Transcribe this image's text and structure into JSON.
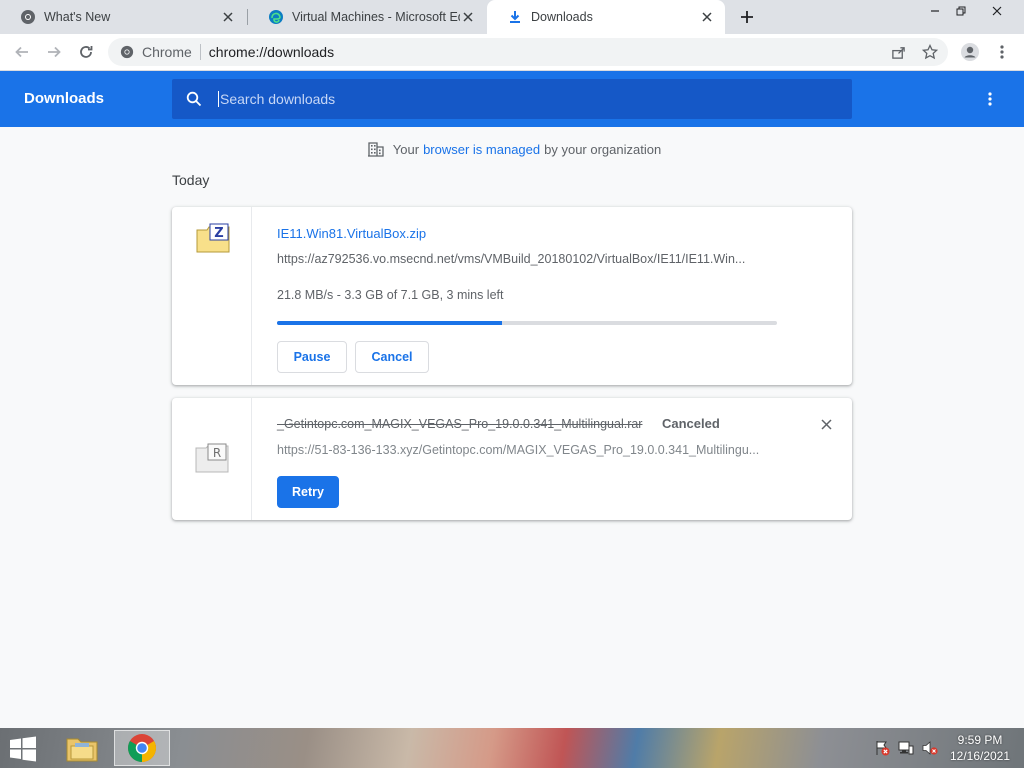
{
  "tabs": [
    {
      "title": "What's New",
      "icon": "chrome-icon"
    },
    {
      "title": "Virtual Machines - Microsoft Edg",
      "icon": "edge-icon"
    },
    {
      "title": "Downloads",
      "icon": "download-icon",
      "active": true
    }
  ],
  "toolbar": {
    "omnibox_scheme_label": "Chrome",
    "url": "chrome://downloads"
  },
  "header": {
    "title": "Downloads",
    "search_placeholder": "Search downloads"
  },
  "managed": {
    "prefix": "Your",
    "link": "browser is managed",
    "suffix": "by your organization"
  },
  "section_label": "Today",
  "downloads": [
    {
      "filename": "IE11.Win81.VirtualBox.zip",
      "url": "https://az792536.vo.msecnd.net/vms/VMBuild_20180102/VirtualBox/IE11/IE11.Win...",
      "status": "21.8 MB/s - 3.3 GB of 7.1 GB, 3 mins left",
      "progress_fraction": 0.45,
      "pause_label": "Pause",
      "cancel_label": "Cancel",
      "file_icon": "zip-file-icon"
    },
    {
      "filename": "_Getintopc.com_MAGIX_VEGAS_Pro_19.0.0.341_Multilingual.rar",
      "state_label": "Canceled",
      "url": "https://51-83-136-133.xyz/Getintopc.com/MAGIX_VEGAS_Pro_19.0.0.341_Multilingu...",
      "retry_label": "Retry",
      "file_icon": "rar-file-icon"
    }
  ],
  "taskbar": {
    "time": "9:59 PM",
    "date": "12/16/2021"
  },
  "colors": {
    "accent": "#1a73e8",
    "header_bg": "#1a73e8",
    "search_bg": "#1558c7"
  }
}
